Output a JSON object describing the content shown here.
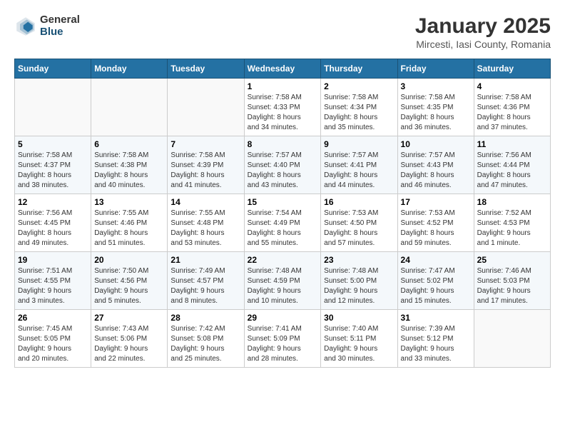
{
  "logo": {
    "general": "General",
    "blue": "Blue"
  },
  "title": "January 2025",
  "subtitle": "Mircesti, Iasi County, Romania",
  "headers": [
    "Sunday",
    "Monday",
    "Tuesday",
    "Wednesday",
    "Thursday",
    "Friday",
    "Saturday"
  ],
  "weeks": [
    [
      {
        "day": "",
        "info": ""
      },
      {
        "day": "",
        "info": ""
      },
      {
        "day": "",
        "info": ""
      },
      {
        "day": "1",
        "info": "Sunrise: 7:58 AM\nSunset: 4:33 PM\nDaylight: 8 hours\nand 34 minutes."
      },
      {
        "day": "2",
        "info": "Sunrise: 7:58 AM\nSunset: 4:34 PM\nDaylight: 8 hours\nand 35 minutes."
      },
      {
        "day": "3",
        "info": "Sunrise: 7:58 AM\nSunset: 4:35 PM\nDaylight: 8 hours\nand 36 minutes."
      },
      {
        "day": "4",
        "info": "Sunrise: 7:58 AM\nSunset: 4:36 PM\nDaylight: 8 hours\nand 37 minutes."
      }
    ],
    [
      {
        "day": "5",
        "info": "Sunrise: 7:58 AM\nSunset: 4:37 PM\nDaylight: 8 hours\nand 38 minutes."
      },
      {
        "day": "6",
        "info": "Sunrise: 7:58 AM\nSunset: 4:38 PM\nDaylight: 8 hours\nand 40 minutes."
      },
      {
        "day": "7",
        "info": "Sunrise: 7:58 AM\nSunset: 4:39 PM\nDaylight: 8 hours\nand 41 minutes."
      },
      {
        "day": "8",
        "info": "Sunrise: 7:57 AM\nSunset: 4:40 PM\nDaylight: 8 hours\nand 43 minutes."
      },
      {
        "day": "9",
        "info": "Sunrise: 7:57 AM\nSunset: 4:41 PM\nDaylight: 8 hours\nand 44 minutes."
      },
      {
        "day": "10",
        "info": "Sunrise: 7:57 AM\nSunset: 4:43 PM\nDaylight: 8 hours\nand 46 minutes."
      },
      {
        "day": "11",
        "info": "Sunrise: 7:56 AM\nSunset: 4:44 PM\nDaylight: 8 hours\nand 47 minutes."
      }
    ],
    [
      {
        "day": "12",
        "info": "Sunrise: 7:56 AM\nSunset: 4:45 PM\nDaylight: 8 hours\nand 49 minutes."
      },
      {
        "day": "13",
        "info": "Sunrise: 7:55 AM\nSunset: 4:46 PM\nDaylight: 8 hours\nand 51 minutes."
      },
      {
        "day": "14",
        "info": "Sunrise: 7:55 AM\nSunset: 4:48 PM\nDaylight: 8 hours\nand 53 minutes."
      },
      {
        "day": "15",
        "info": "Sunrise: 7:54 AM\nSunset: 4:49 PM\nDaylight: 8 hours\nand 55 minutes."
      },
      {
        "day": "16",
        "info": "Sunrise: 7:53 AM\nSunset: 4:50 PM\nDaylight: 8 hours\nand 57 minutes."
      },
      {
        "day": "17",
        "info": "Sunrise: 7:53 AM\nSunset: 4:52 PM\nDaylight: 8 hours\nand 59 minutes."
      },
      {
        "day": "18",
        "info": "Sunrise: 7:52 AM\nSunset: 4:53 PM\nDaylight: 9 hours\nand 1 minute."
      }
    ],
    [
      {
        "day": "19",
        "info": "Sunrise: 7:51 AM\nSunset: 4:55 PM\nDaylight: 9 hours\nand 3 minutes."
      },
      {
        "day": "20",
        "info": "Sunrise: 7:50 AM\nSunset: 4:56 PM\nDaylight: 9 hours\nand 5 minutes."
      },
      {
        "day": "21",
        "info": "Sunrise: 7:49 AM\nSunset: 4:57 PM\nDaylight: 9 hours\nand 8 minutes."
      },
      {
        "day": "22",
        "info": "Sunrise: 7:48 AM\nSunset: 4:59 PM\nDaylight: 9 hours\nand 10 minutes."
      },
      {
        "day": "23",
        "info": "Sunrise: 7:48 AM\nSunset: 5:00 PM\nDaylight: 9 hours\nand 12 minutes."
      },
      {
        "day": "24",
        "info": "Sunrise: 7:47 AM\nSunset: 5:02 PM\nDaylight: 9 hours\nand 15 minutes."
      },
      {
        "day": "25",
        "info": "Sunrise: 7:46 AM\nSunset: 5:03 PM\nDaylight: 9 hours\nand 17 minutes."
      }
    ],
    [
      {
        "day": "26",
        "info": "Sunrise: 7:45 AM\nSunset: 5:05 PM\nDaylight: 9 hours\nand 20 minutes."
      },
      {
        "day": "27",
        "info": "Sunrise: 7:43 AM\nSunset: 5:06 PM\nDaylight: 9 hours\nand 22 minutes."
      },
      {
        "day": "28",
        "info": "Sunrise: 7:42 AM\nSunset: 5:08 PM\nDaylight: 9 hours\nand 25 minutes."
      },
      {
        "day": "29",
        "info": "Sunrise: 7:41 AM\nSunset: 5:09 PM\nDaylight: 9 hours\nand 28 minutes."
      },
      {
        "day": "30",
        "info": "Sunrise: 7:40 AM\nSunset: 5:11 PM\nDaylight: 9 hours\nand 30 minutes."
      },
      {
        "day": "31",
        "info": "Sunrise: 7:39 AM\nSunset: 5:12 PM\nDaylight: 9 hours\nand 33 minutes."
      },
      {
        "day": "",
        "info": ""
      }
    ]
  ]
}
